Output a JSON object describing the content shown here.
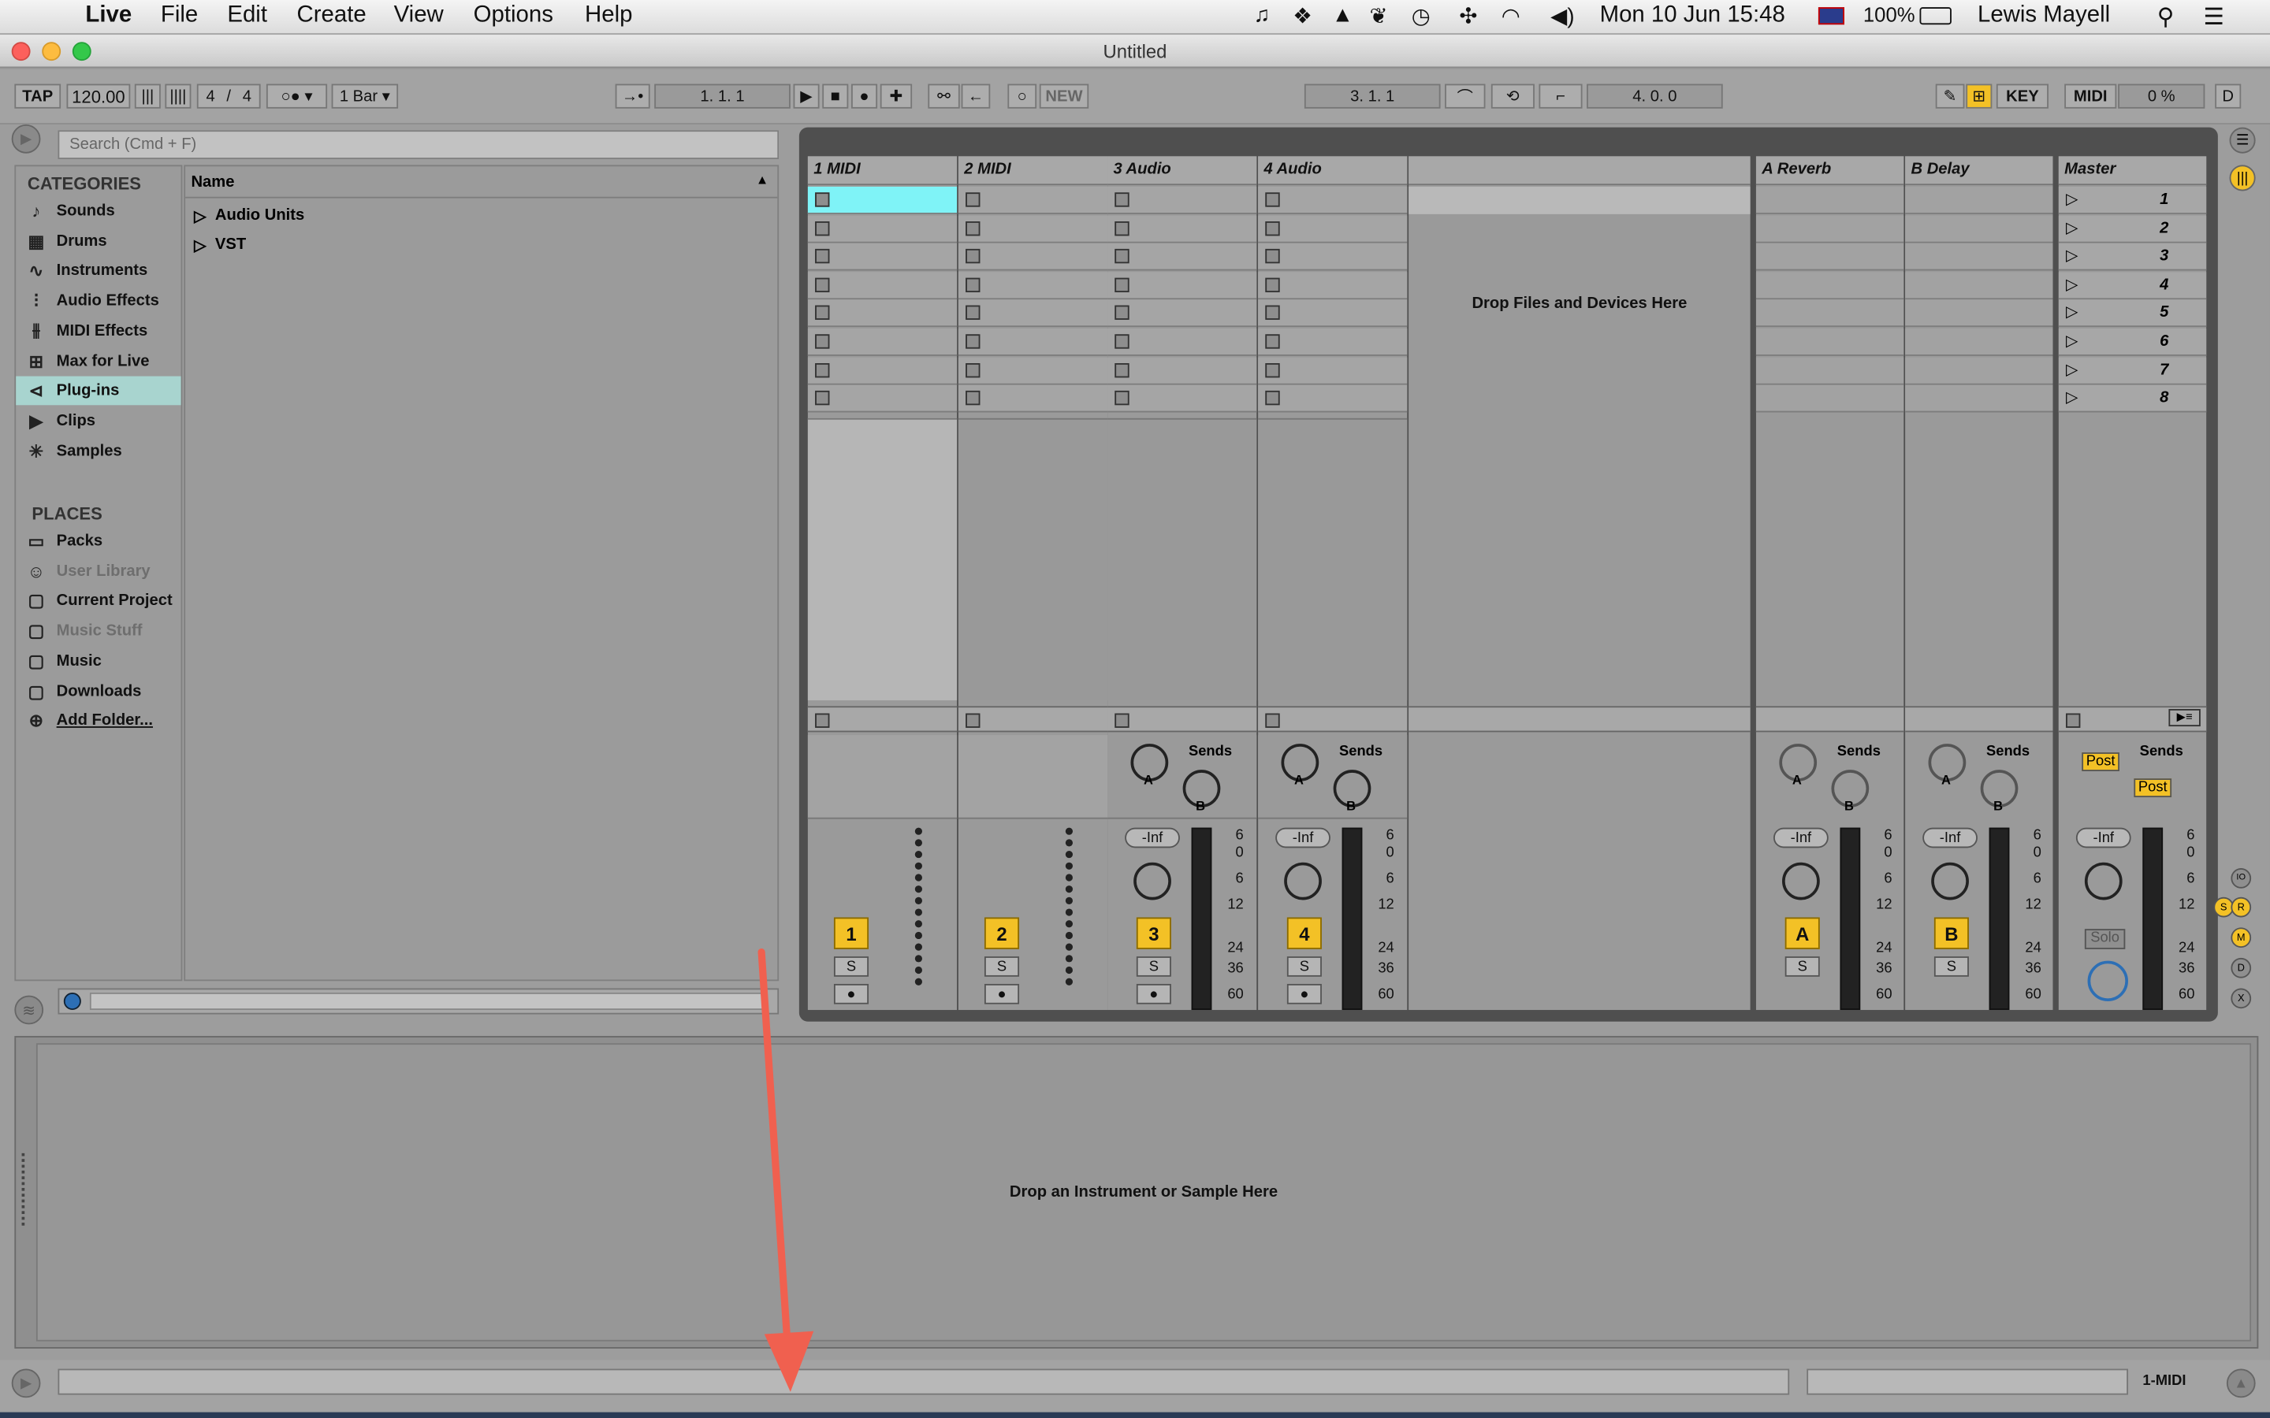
{
  "menubar": {
    "app": "Live",
    "items": [
      "File",
      "Edit",
      "Create",
      "View",
      "Options",
      "Help"
    ],
    "clock": "Mon 10 Jun  15:48",
    "battery": "100%",
    "user": "Lewis Mayell"
  },
  "window": {
    "title": "Untitled"
  },
  "control_bar": {
    "tap": "TAP",
    "tempo": "120.00",
    "signature_num": "4",
    "signature_den": "4",
    "quantize": "1 Bar",
    "arrangement_position": "1.   1.   1",
    "new_label": "NEW",
    "loop_start": "3.   1.   1",
    "loop_length": "4.   0.   0",
    "key_label": "KEY",
    "midi_label": "MIDI",
    "cpu": "0 %",
    "d_label": "D"
  },
  "browser": {
    "search_placeholder": "Search (Cmd + F)",
    "categories_title": "CATEGORIES",
    "categories": [
      {
        "label": "Sounds",
        "icon": "note-icon"
      },
      {
        "label": "Drums",
        "icon": "grid-icon"
      },
      {
        "label": "Instruments",
        "icon": "wave-icon"
      },
      {
        "label": "Audio Effects",
        "icon": "audio-fx-icon"
      },
      {
        "label": "MIDI Effects",
        "icon": "midi-fx-icon"
      },
      {
        "label": "Max for Live",
        "icon": "max-icon"
      },
      {
        "label": "Plug-ins",
        "icon": "plugin-icon"
      },
      {
        "label": "Clips",
        "icon": "clip-icon"
      },
      {
        "label": "Samples",
        "icon": "sample-icon"
      }
    ],
    "selected_category": "Plug-ins",
    "places_title": "PLACES",
    "places": [
      {
        "label": "Packs",
        "dim": false
      },
      {
        "label": "User Library",
        "dim": true
      },
      {
        "label": "Current Project",
        "dim": false
      },
      {
        "label": "Music Stuff",
        "dim": true
      },
      {
        "label": "Music",
        "dim": false
      },
      {
        "label": "Downloads",
        "dim": false
      },
      {
        "label": "Add Folder...",
        "dim": false
      }
    ],
    "column_header": "Name",
    "items": [
      "Audio Units",
      "VST"
    ]
  },
  "session": {
    "tracks": [
      {
        "name": "1 MIDI",
        "type": "midi",
        "number": "1"
      },
      {
        "name": "2 MIDI",
        "type": "midi",
        "number": "2"
      },
      {
        "name": "3 Audio",
        "type": "audio",
        "number": "3"
      },
      {
        "name": "4 Audio",
        "type": "audio",
        "number": "4"
      }
    ],
    "drop_text": "Drop Files and Devices Here",
    "returns": [
      {
        "name": "A Reverb",
        "letter": "A"
      },
      {
        "name": "B Delay",
        "letter": "B"
      }
    ],
    "master": {
      "name": "Master",
      "scenes": [
        "1",
        "2",
        "3",
        "4",
        "5",
        "6",
        "7",
        "8"
      ]
    },
    "sends_label": "Sends",
    "send_a": "A",
    "send_b": "B",
    "volume": "-Inf",
    "solo": "S",
    "post": "Post",
    "master_solo": "Solo",
    "meter_scale": [
      "6",
      "0",
      "6",
      "12",
      "24",
      "36",
      "60"
    ]
  },
  "detail": {
    "drop_text": "Drop an Instrument or Sample Here"
  },
  "status": {
    "selected_track": "1-MIDI"
  },
  "arrow_color": "#f0604f",
  "clip_highlight": "#7ff3f7",
  "accent_yellow": "#f3c126"
}
